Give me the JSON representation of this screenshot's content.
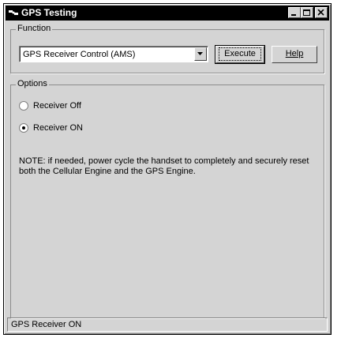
{
  "window": {
    "title": "GPS Testing",
    "controls": [
      "minimize-icon",
      "maximize-icon",
      "close-icon"
    ]
  },
  "function_group": {
    "label": "Function",
    "select_value": "GPS Receiver Control (AMS)",
    "execute_label": "Execute",
    "help_label": "Help"
  },
  "options_group": {
    "label": "Options",
    "radios": [
      {
        "label": "Receiver Off",
        "checked": false
      },
      {
        "label": "Receiver ON",
        "checked": true
      }
    ],
    "note": "NOTE: if needed, power cycle the handset to completely and securely reset both the Cellular Engine and the GPS Engine."
  },
  "status_bar": {
    "text": "GPS Receiver ON"
  },
  "colors": {
    "face": "#d4d4d4",
    "title_bar": "#000000"
  }
}
